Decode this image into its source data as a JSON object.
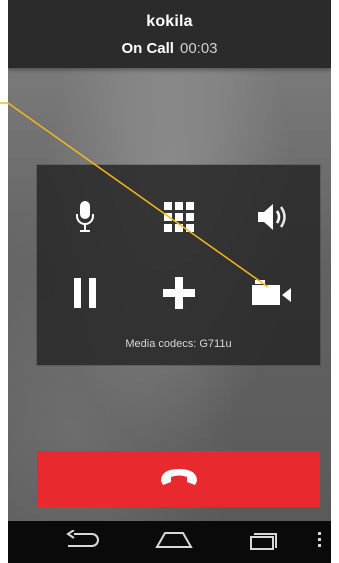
{
  "call": {
    "caller_name": "kokila",
    "status_label": "On Call",
    "timer": "00:03"
  },
  "controls": {
    "row1": [
      {
        "icon": "microphone-icon",
        "action": "mute"
      },
      {
        "icon": "dialpad-icon",
        "action": "dialpad"
      },
      {
        "icon": "speaker-icon",
        "action": "speaker"
      }
    ],
    "row2": [
      {
        "icon": "pause-icon",
        "action": "hold"
      },
      {
        "icon": "plus-icon",
        "action": "add-call"
      },
      {
        "icon": "video-camera-icon",
        "action": "video"
      }
    ],
    "codec_text": "Media codecs: G711u"
  },
  "hangup": {
    "icon": "hangup-phone-icon"
  },
  "navbar": {
    "items": [
      {
        "icon": "back-icon"
      },
      {
        "icon": "home-icon"
      },
      {
        "icon": "recent-apps-icon"
      },
      {
        "icon": "overflow-menu-icon"
      }
    ]
  },
  "colors": {
    "header_bg": "#2b2b2b",
    "panel_bg": "#282828",
    "hangup_red": "#e8292d",
    "annotation_line": "#f3b81a",
    "navbar_bg": "#0a0a0a"
  }
}
